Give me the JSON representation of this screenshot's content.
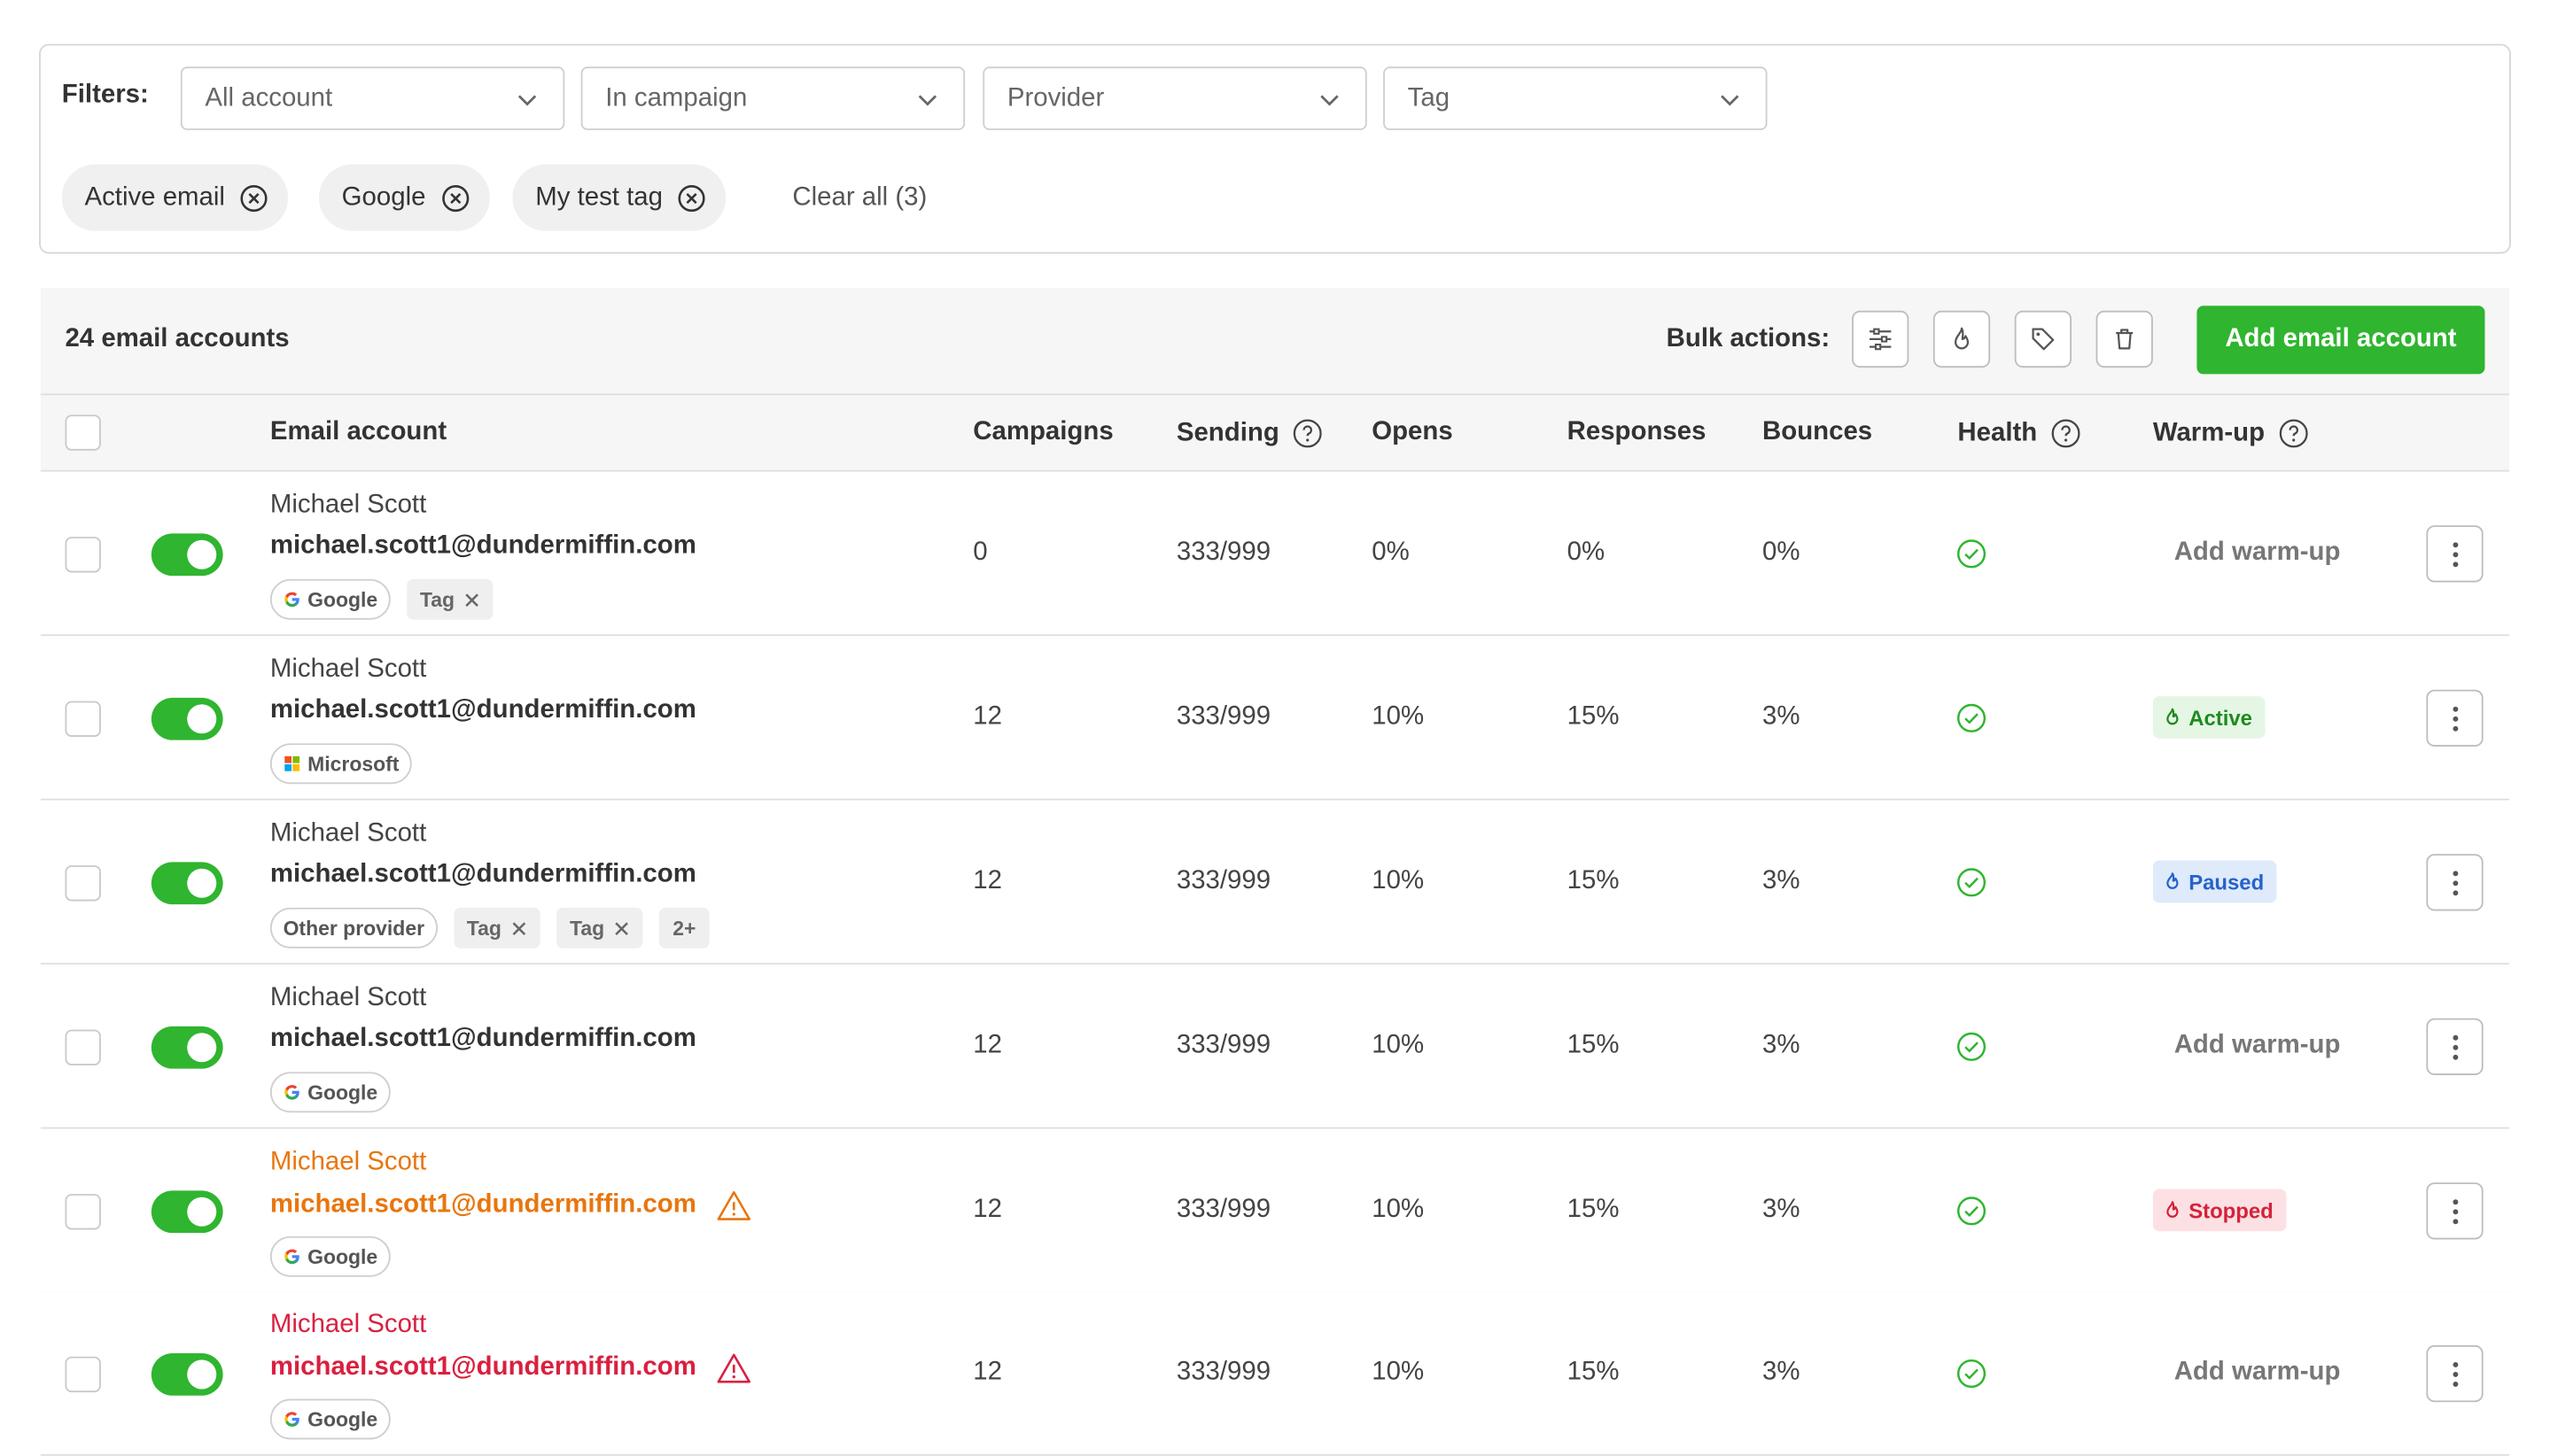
{
  "filters": {
    "label": "Filters:",
    "selects": [
      "All account",
      "In campaign",
      "Provider",
      "Tag"
    ],
    "chips": [
      "Active email",
      "Google",
      "My test tag"
    ],
    "clear_all": "Clear all (3)"
  },
  "table": {
    "count": "24 email accounts",
    "bulk_label": "Bulk actions:",
    "add_button": "Add email account",
    "columns": {
      "email": "Email account",
      "campaigns": "Campaigns",
      "sending": "Sending",
      "opens": "Opens",
      "responses": "Responses",
      "bounces": "Bounces",
      "health": "Health",
      "warmup": "Warm-up"
    }
  },
  "rows": [
    {
      "name": "Michael Scott",
      "email": "michael.scott1@dundermiffin.com",
      "provider": "Google",
      "tags": [
        "Tag"
      ],
      "extra": "",
      "campaigns": "0",
      "sending": "333/999",
      "opens": "0%",
      "responses": "0%",
      "bounces": "0%",
      "warmup": "Add warm-up",
      "state": "normal"
    },
    {
      "name": "Michael Scott",
      "email": "michael.scott1@dundermiffin.com",
      "provider": "Microsoft",
      "tags": [],
      "extra": "",
      "campaigns": "12",
      "sending": "333/999",
      "opens": "10%",
      "responses": "15%",
      "bounces": "3%",
      "warmup": "Active",
      "state": "normal"
    },
    {
      "name": "Michael Scott",
      "email": "michael.scott1@dundermiffin.com",
      "provider": "Other provider",
      "tags": [
        "Tag",
        "Tag"
      ],
      "extra": "2+",
      "campaigns": "12",
      "sending": "333/999",
      "opens": "10%",
      "responses": "15%",
      "bounces": "3%",
      "warmup": "Paused",
      "state": "normal"
    },
    {
      "name": "Michael Scott",
      "email": "michael.scott1@dundermiffin.com",
      "provider": "Google",
      "tags": [],
      "extra": "",
      "campaigns": "12",
      "sending": "333/999",
      "opens": "10%",
      "responses": "15%",
      "bounces": "3%",
      "warmup": "Add warm-up",
      "state": "normal"
    },
    {
      "name": "Michael Scott",
      "email": "michael.scott1@dundermiffin.com",
      "provider": "Google",
      "tags": [],
      "extra": "",
      "campaigns": "12",
      "sending": "333/999",
      "opens": "10%",
      "responses": "15%",
      "bounces": "3%",
      "warmup": "Stopped",
      "state": "warning"
    },
    {
      "name": "Michael Scott",
      "email": "michael.scott1@dundermiffin.com",
      "provider": "Google",
      "tags": [],
      "extra": "",
      "campaigns": "12",
      "sending": "333/999",
      "opens": "10%",
      "responses": "15%",
      "bounces": "3%",
      "warmup": "Add warm-up",
      "state": "error"
    }
  ],
  "colors": {
    "accent": "#2fb52f",
    "warning": "#e8760e",
    "error": "#d92040",
    "paused": "#2563c9"
  },
  "icons": {
    "bulk": [
      "sliders-icon",
      "flame-icon",
      "tag-icon",
      "trash-icon"
    ]
  }
}
